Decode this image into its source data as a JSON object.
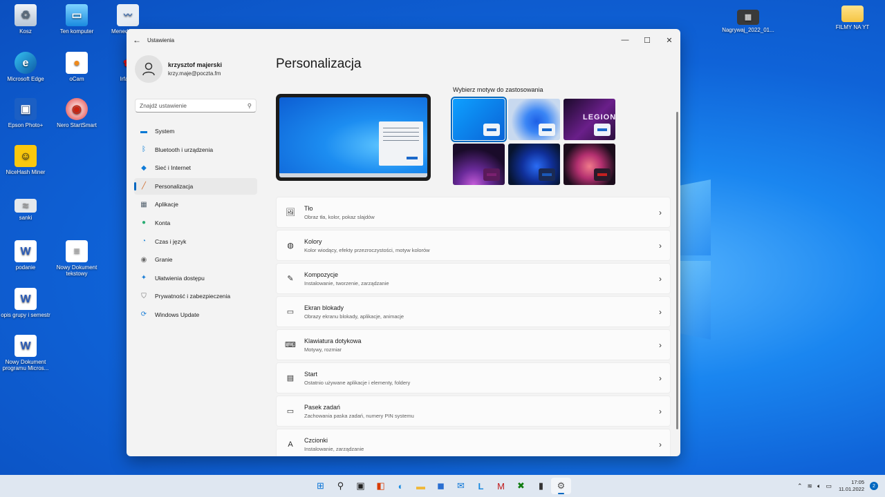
{
  "desktop": {
    "icons": [
      {
        "label": "Kosz",
        "icon": "recycle-bin-icon"
      },
      {
        "label": "Ten komputer",
        "icon": "this-pc-icon"
      },
      {
        "label": "Menedż... s...",
        "icon": "task-manager-icon"
      },
      {
        "label": "Microsoft Edge",
        "icon": "edge-icon"
      },
      {
        "label": "oCam",
        "icon": "ocam-icon"
      },
      {
        "label": "Irfan...",
        "icon": "irfanview-icon"
      },
      {
        "label": "Epson Photo+",
        "icon": "epson-icon"
      },
      {
        "label": "Nero StartSmart",
        "icon": "nero-icon"
      },
      {
        "label": "NiceHash Miner",
        "icon": "nicehash-icon"
      },
      {
        "label": "sanki",
        "icon": "image-file-icon"
      },
      {
        "label": "podanie",
        "icon": "word-doc-icon"
      },
      {
        "label": "Nowy Dokument tekstowy",
        "icon": "text-file-icon"
      },
      {
        "label": "opis grupy i semestr",
        "icon": "word-doc-icon"
      },
      {
        "label": "Nowy Dokument programu Micros...",
        "icon": "word-doc-icon"
      },
      {
        "label": "Nagrywaj_2022_01...",
        "icon": "video-file-icon"
      },
      {
        "label": "FILMY NA YT",
        "icon": "folder-icon"
      }
    ]
  },
  "window": {
    "title": "Ustawienia",
    "profile": {
      "name": "krzysztof majerski",
      "email": "krzy.maje@poczta.fm"
    },
    "search_placeholder": "Znajdź ustawienie",
    "nav": [
      {
        "label": "System",
        "icon": "system-icon",
        "color": "#0078d4"
      },
      {
        "label": "Bluetooth i urządzenia",
        "icon": "bluetooth-icon",
        "color": "#0078d4"
      },
      {
        "label": "Sieć i Internet",
        "icon": "network-icon",
        "color": "#0f7bd8"
      },
      {
        "label": "Personalizacja",
        "icon": "brush-icon",
        "color": "#d06a2a"
      },
      {
        "label": "Aplikacje",
        "icon": "apps-icon",
        "color": "#52606d"
      },
      {
        "label": "Konta",
        "icon": "accounts-icon",
        "color": "#2bad74"
      },
      {
        "label": "Czas i język",
        "icon": "time-language-icon",
        "color": "#2a8bd6"
      },
      {
        "label": "Granie",
        "icon": "gaming-icon",
        "color": "#6b6b6b"
      },
      {
        "label": "Ułatwienia dostępu",
        "icon": "accessibility-icon",
        "color": "#1d7fd6"
      },
      {
        "label": "Prywatność i zabezpieczenia",
        "icon": "shield-icon",
        "color": "#6b6b6b"
      },
      {
        "label": "Windows Update",
        "icon": "update-icon",
        "color": "#1d7fd6"
      }
    ],
    "active_nav": "Personalizacja",
    "page_title": "Personalizacja",
    "themes_label": "Wybierz motyw do zastosowania",
    "theme_chip_colors": [
      "#1b68c9",
      "#1b68c9",
      "#1b68c9",
      "#7a2070",
      "#1b58b8",
      "#c42020"
    ],
    "theme_text": "LEGION",
    "items": [
      {
        "title": "Tło",
        "subtitle": "Obraz tła, kolor, pokaz slajdów",
        "icon": "image-icon"
      },
      {
        "title": "Kolory",
        "subtitle": "Kolor wiodący, efekty przezroczystości, motyw kolorów",
        "icon": "palette-icon"
      },
      {
        "title": "Kompozycje",
        "subtitle": "Instalowanie, tworzenie, zarządzanie",
        "icon": "pen-icon"
      },
      {
        "title": "Ekran blokady",
        "subtitle": "Obrazy ekranu blokady, aplikacje, animacje",
        "icon": "lock-screen-icon"
      },
      {
        "title": "Klawiatura dotykowa",
        "subtitle": "Motywy, rozmiar",
        "icon": "keyboard-icon"
      },
      {
        "title": "Start",
        "subtitle": "Ostatnio używane aplikacje i elementy, foldery",
        "icon": "start-icon"
      },
      {
        "title": "Pasek zadań",
        "subtitle": "Zachowania paska zadań, numery PIN systemu",
        "icon": "taskbar-icon"
      },
      {
        "title": "Czcionki",
        "subtitle": "Instalowanie, zarządzanie",
        "icon": "fonts-icon"
      }
    ]
  },
  "taskbar": {
    "apps": [
      "start-icon",
      "search-icon",
      "task-view-icon",
      "office-icon",
      "edge-icon",
      "file-explorer-icon",
      "store-icon",
      "mail-icon",
      "l-app-icon",
      "mcafee-icon",
      "xbox-icon",
      "terminal-icon",
      "settings-icon"
    ],
    "time": "17:05",
    "date": "11.01.2022",
    "notifications": "2"
  }
}
